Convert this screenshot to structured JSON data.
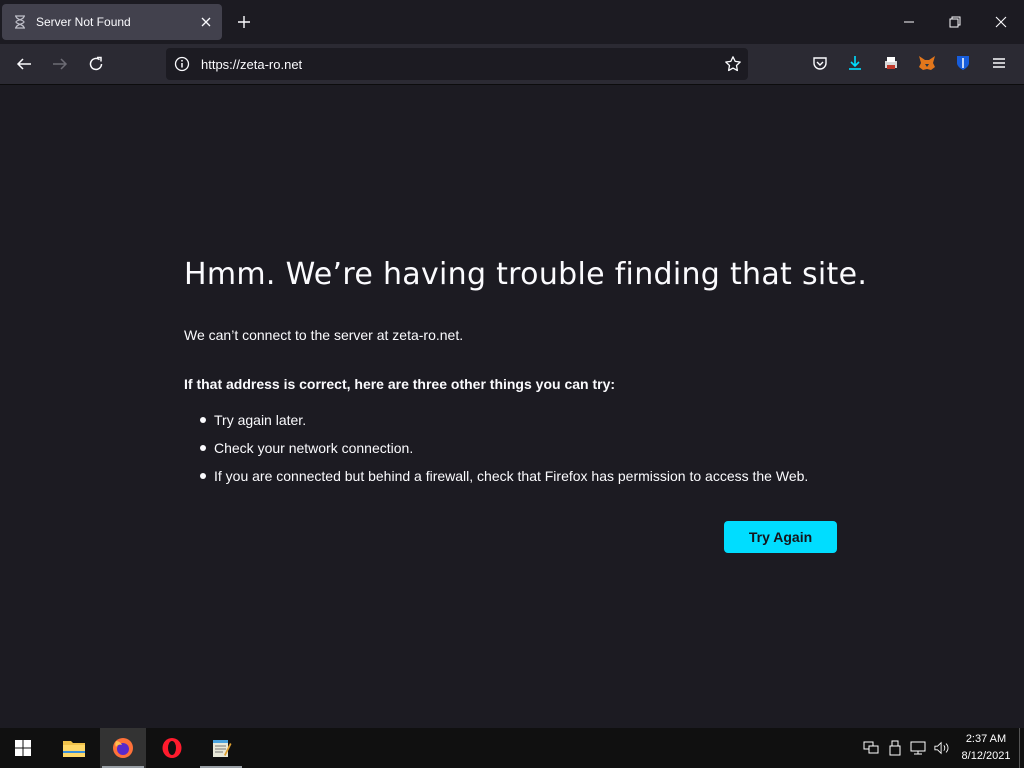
{
  "tab": {
    "title": "Server Not Found",
    "icon": "hourglass-icon"
  },
  "navbar": {
    "url": "https://zeta-ro.net"
  },
  "error": {
    "title": "Hmm. We’re having trouble finding that site.",
    "description": "We can’t connect to the server at zeta-ro.net.",
    "heading": "If that address is correct, here are three other things you can try:",
    "suggestions": [
      "Try again later.",
      "Check your network connection.",
      "If you are connected but behind a firewall, check that Firefox has permission to access the Web."
    ],
    "button_label": "Try Again"
  },
  "taskbar": {
    "time": "2:37 AM",
    "date": "8/12/2021",
    "apps": [
      "file-explorer-icon",
      "firefox-icon",
      "opera-icon",
      "notepad-icon"
    ]
  },
  "colors": {
    "accent": "#00ddff",
    "background": "#1c1b22",
    "toolbar": "#2b2a33",
    "tab_active": "#42414d"
  }
}
